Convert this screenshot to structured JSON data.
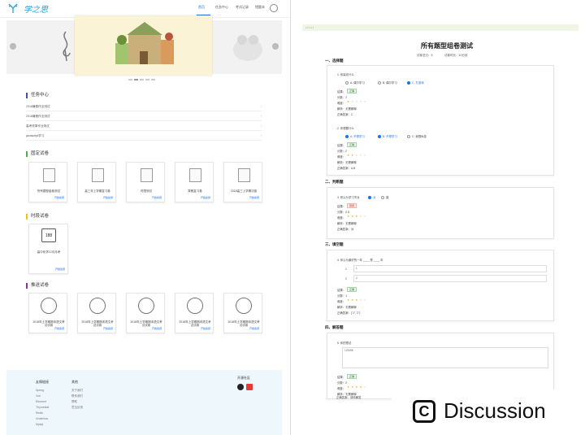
{
  "nav": {
    "logo_text": "学之思",
    "links": [
      "首页",
      "任务中心",
      "考试记录",
      "错题本"
    ]
  },
  "task_center": {
    "title": "任务中心",
    "rows": [
      "2018暑假作业测试",
      "2018暑假作业测试",
      "高考改革作业测试",
      "javascript学习"
    ]
  },
  "fixed_papers": {
    "title": "固定试卷",
    "cards": [
      {
        "name": "所有题型组卷测试",
        "btn": "开始答题"
      },
      {
        "name": "高三年上学期复习卷",
        "btn": "开始答题"
      },
      {
        "name": "时限测试",
        "btn": "开始答题"
      },
      {
        "name": "寒假复习卷",
        "btn": "开始答题"
      },
      {
        "name": "2018高三上学期试卷",
        "btn": "开始答题"
      }
    ]
  },
  "timed_papers": {
    "title": "时段试卷",
    "card": {
      "cal": "188",
      "name": "高中化学12月月考",
      "btn": "开始答题"
    }
  },
  "push_papers": {
    "title": "推送试卷",
    "cards": [
      {
        "name": "2018年上学期期末语文考试试卷",
        "btn": "开始答题"
      },
      {
        "name": "2018年上学期期末语文考试试卷",
        "btn": "开始答题"
      },
      {
        "name": "2018年上学期期末语文考试试卷",
        "btn": "开始答题"
      },
      {
        "name": "2018年上学期期末语文考试试卷",
        "btn": "开始答题"
      },
      {
        "name": "2018年上学期期末语文考试试卷",
        "btn": "开始答题"
      }
    ]
  },
  "footer": {
    "col1_title": "友情链接",
    "col1_links": [
      "Spring",
      "Vue",
      "Element",
      "Thymeleaf",
      "Redis",
      "Undertow",
      "Mysql"
    ],
    "col2_title": "其他",
    "col2_links": [
      "关于我们",
      "联系我们",
      "帮助",
      "意见反馈"
    ],
    "open_title": "开源社区"
  },
  "paper": {
    "crumb": "• • • • •",
    "title": "所有题型组卷测试",
    "meta_score": "试卷总分：5",
    "meta_time": "试卷时长：10分钟",
    "sections": [
      "一、选择题",
      "二、判断题",
      "三、填空题",
      "四、解答题"
    ],
    "q1": {
      "stem": "1.  你喜欢什么",
      "opts": [
        "A. 偶尔学习",
        "B. 偶尔学习",
        "C. 打游戏"
      ],
      "result_label": "结果：",
      "result": "正确",
      "score_label": "分数：2",
      "diff_label": "难度：",
      "analysis": "解析：无需解释",
      "answer": "正确答案：C"
    },
    "q2": {
      "stem": "2.  你想要什么",
      "opts": [
        "A. 不想学习",
        "B. 不想学习",
        "C. 我想休息"
      ],
      "result_label": "结果：",
      "result": "正确",
      "score_label": "分数：2",
      "diff_label": "难度：",
      "analysis": "解析：无需解释",
      "answer": "正确答案：A,B"
    },
    "q3": {
      "stem": "3.  你认为学习不对",
      "opts": [
        "对",
        "错"
      ],
      "result_label": "结果：",
      "result": "错误",
      "score_label": "分数：0.5",
      "diff_label": "难度：",
      "analysis": "解析：无需解释",
      "answer": "正确答案：对"
    },
    "q4": {
      "stem": "4.  你认为最好的一年 ____ 是 ____ 年",
      "blank1": "1",
      "blank2": "2",
      "result_label": "结果：",
      "result": "正确",
      "score_label": "分数：1",
      "diff_label": "难度：",
      "analysis": "解析：无需解释",
      "answer": "正确答案：[\"1\",\"2\"]"
    },
    "q5": {
      "stem": "5.  你的想法",
      "answer_text": "123456",
      "result_label": "结果：",
      "result": "正确",
      "score_label": "分数：2",
      "diff_label": "难度：",
      "analysis": "解析：无需解释",
      "answer": "正确答案：请你解答"
    }
  },
  "discussion": {
    "icon": "C",
    "label": "Discussion"
  }
}
